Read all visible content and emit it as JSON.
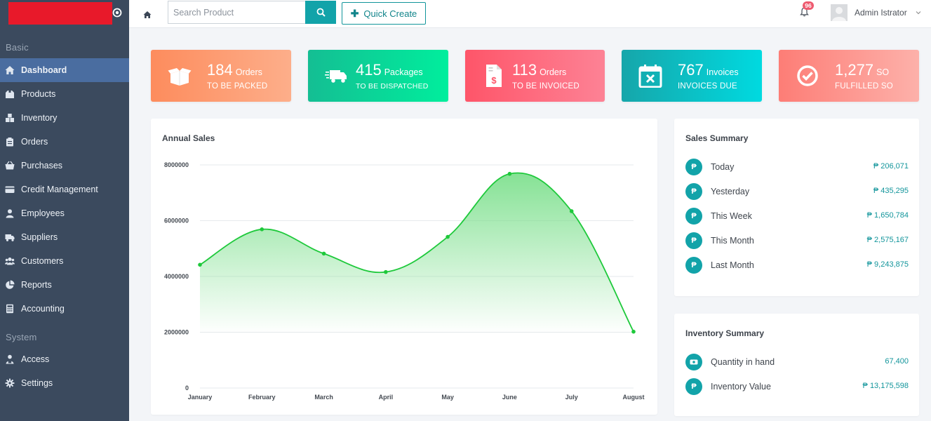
{
  "sidebar": {
    "sections": [
      {
        "title": "Basic",
        "items": [
          {
            "label": "Dashboard",
            "icon": "home-icon",
            "active": true
          },
          {
            "label": "Products",
            "icon": "box-icon"
          },
          {
            "label": "Inventory",
            "icon": "boxes-icon"
          },
          {
            "label": "Orders",
            "icon": "clipboard-icon"
          },
          {
            "label": "Purchases",
            "icon": "basket-icon"
          },
          {
            "label": "Credit Management",
            "icon": "credit-card-icon"
          },
          {
            "label": "Employees",
            "icon": "user-icon"
          },
          {
            "label": "Suppliers",
            "icon": "truck-icon"
          },
          {
            "label": "Customers",
            "icon": "users-icon"
          },
          {
            "label": "Reports",
            "icon": "pie-chart-icon"
          },
          {
            "label": "Accounting",
            "icon": "calculator-icon"
          }
        ]
      },
      {
        "title": "System",
        "items": [
          {
            "label": "Access",
            "icon": "user-lock-icon"
          },
          {
            "label": "Settings",
            "icon": "gear-icon"
          }
        ]
      }
    ]
  },
  "topbar": {
    "search_placeholder": "Search Product",
    "quick_create_label": "Quick Create",
    "notification_count": "96",
    "user_name": "Admin Istrator"
  },
  "stats": [
    {
      "value": "184",
      "unit": "Orders",
      "caption": "TO BE PACKED",
      "icon": "open-box-icon",
      "colors": [
        "#fd8c5d",
        "#fdae8a"
      ]
    },
    {
      "value": "415",
      "unit": "Packages",
      "caption": "TO BE DISPATCHED",
      "icon": "delivery-truck-icon",
      "colors": [
        "#14be93",
        "#00ee9d"
      ]
    },
    {
      "value": "113",
      "unit": "Orders",
      "caption": "TO BE INVOICED",
      "icon": "invoice-dollar-icon",
      "colors": [
        "#fe5569",
        "#fd8295"
      ]
    },
    {
      "value": "767",
      "unit": "Invoices",
      "caption": "INVOICES DUE",
      "icon": "calendar-x-icon",
      "colors": [
        "#16a6aa",
        "#00dae0"
      ]
    },
    {
      "value": "1,277",
      "unit": "SO",
      "caption": "FULFILLED SO",
      "icon": "check-circle-icon",
      "colors": [
        "#fd7d76",
        "#fdb1aa"
      ]
    }
  ],
  "annual_sales": {
    "title": "Annual Sales"
  },
  "chart_data": {
    "type": "area",
    "categories": [
      "January",
      "February",
      "March",
      "April",
      "May",
      "June",
      "July",
      "August"
    ],
    "values": [
      4420000,
      5690000,
      4820000,
      4160000,
      5420000,
      7680000,
      6340000,
      2020000
    ],
    "yticks": [
      "8000000",
      "6000000",
      "4000000",
      "2000000",
      "0"
    ],
    "ylim": [
      0,
      8000000
    ],
    "line_color": "#1ec93b",
    "fill_color": "#7fe08f",
    "grid": true,
    "legend": false
  },
  "sales_summary": {
    "title": "Sales Summary",
    "rows": [
      {
        "label": "Today",
        "value": "₱ 206,071"
      },
      {
        "label": "Yesterday",
        "value": "₱ 435,295"
      },
      {
        "label": "This Week",
        "value": "₱ 1,650,784"
      },
      {
        "label": "This Month",
        "value": "₱ 2,575,167"
      },
      {
        "label": "Last Month",
        "value": "₱ 9,243,875"
      }
    ]
  },
  "inventory_summary": {
    "title": "Inventory Summary",
    "rows": [
      {
        "label": "Quantity in hand",
        "value": "67,400",
        "icon": "cash-icon"
      },
      {
        "label": "Inventory Value",
        "value": "₱ 13,175,598",
        "icon": "peso-icon"
      }
    ]
  },
  "colors": {
    "accent": "#12a3a9",
    "sidebar_bg": "#3b4a5e",
    "sidebar_active": "#4a6da0",
    "badge_red": "#ee5a6f",
    "brand_logo": "#e8192a"
  }
}
